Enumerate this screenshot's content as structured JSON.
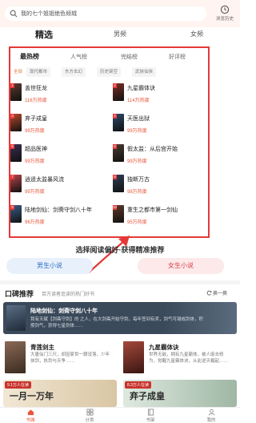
{
  "search": {
    "placeholder": "我的七个姐姐绝色倾城"
  },
  "history": {
    "label": "浏览历史"
  },
  "channel_tabs": [
    {
      "label": "精选",
      "active": true
    },
    {
      "label": "男频",
      "active": false
    },
    {
      "label": "女频",
      "active": false
    }
  ],
  "rank_tabs": [
    {
      "label": "最热榜",
      "active": true
    },
    {
      "label": "人气榜",
      "active": false
    },
    {
      "label": "完结榜",
      "active": false
    },
    {
      "label": "好评榜",
      "active": false
    }
  ],
  "chips": [
    {
      "label": "全部",
      "active": true
    },
    {
      "label": "现代都市",
      "active": false
    },
    {
      "label": "东方玄幻",
      "active": false
    },
    {
      "label": "历史架空",
      "active": false
    },
    {
      "label": "武侠仙侠",
      "active": false
    }
  ],
  "books_left": [
    {
      "rank": "1",
      "title": "盖世狂龙",
      "heat": "116万热度",
      "color": "#5b3a2c"
    },
    {
      "rank": "3",
      "title": "弃子成皇",
      "heat": "99万热度",
      "color": "#b84a2b"
    },
    {
      "rank": "5",
      "title": "超品医神",
      "heat": "99万热度",
      "color": "#3a2e52"
    },
    {
      "rank": "7",
      "title": "逍遥太监暴风流",
      "heat": "99万热度",
      "color": "#b9444c"
    },
    {
      "rank": "9",
      "title": "陆地剑仙：剑斋守剑八十年",
      "heat": "96万热度",
      "color": "#3b5e88"
    }
  ],
  "books_right": [
    {
      "rank": "2",
      "title": "九星霸体诀",
      "heat": "114万热度",
      "color": "#7a2e25"
    },
    {
      "rank": "4",
      "title": "天医出狱",
      "heat": "99万热度",
      "color": "#2b4a6a"
    },
    {
      "rank": "6",
      "title": "假太监：从后宫开始",
      "heat": "99万热度",
      "color": "#4a3b30"
    },
    {
      "rank": "8",
      "title": "独断万古",
      "heat": "98万热度",
      "color": "#2f3f55"
    },
    {
      "rank": "10",
      "title": "重生之都市第一剑仙",
      "heat": "95万热度",
      "color": "#5e3a2a"
    }
  ],
  "prompt_text": "选择阅读偏好·获得精准推荐",
  "gender": {
    "male": "男生小说",
    "female": "女生小说"
  },
  "recommend": {
    "title": "口碑推荐",
    "subtitle": "百万读者追读的热门好书",
    "refresh": "换一换"
  },
  "feature": {
    "title": "陆地剑仙：剑斋守剑八十年",
    "desc": "我有天赋【剑斋守剑】的 之人，在大剑斋开始守剑，每年签到有奖，剑气可凝成剑体，积攒剑气，获得七星剑体……"
  },
  "rec_books": [
    {
      "title": "青莲剑主",
      "desc": "大唐仙门三尺，却因家世一朝没落，少年抹剑，执剑与天争……",
      "color": "#6b4a3a"
    },
    {
      "title": "九星霸体诀",
      "desc": "世界无敌，拥有九星霸体，被人废去修为，觉醒九星霸体诀，从此逆天崛起……",
      "color": "#7a2e25"
    }
  ],
  "banners": [
    {
      "badge": "9.1万人在读",
      "text": "一月一万年",
      "color": "#f1e7d4"
    },
    {
      "badge": "8.3万人在读",
      "text": "弃子成皇",
      "color": "#dfe9e0"
    }
  ],
  "bottom_nav": [
    {
      "label": "书城",
      "icon": "home-icon",
      "active": true
    },
    {
      "label": "分类",
      "icon": "grid-icon",
      "active": false
    },
    {
      "label": "书架",
      "icon": "bookshelf-icon",
      "active": false
    },
    {
      "label": "我的",
      "icon": "user-icon",
      "active": false
    }
  ],
  "colors": {
    "accent": "#e8563a",
    "highlight_border": "#e53838"
  }
}
